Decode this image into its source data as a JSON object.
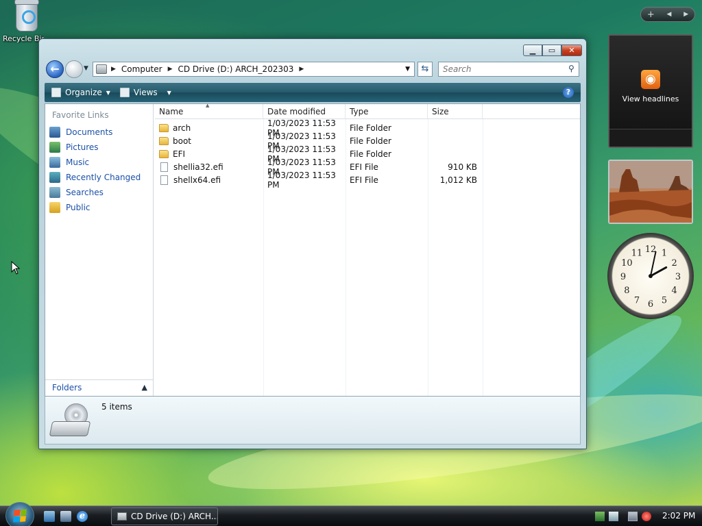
{
  "desktop": {
    "recycle_bin_label": "Recycle Bin"
  },
  "sidebar": {
    "rss_gadget_label": "View headlines",
    "clock_numbers": [
      "12",
      "1",
      "2",
      "3",
      "4",
      "5",
      "6",
      "7",
      "8",
      "9",
      "10",
      "11"
    ],
    "clock_time": {
      "hour": 2,
      "minute": 2
    }
  },
  "window": {
    "address": {
      "segments": [
        "Computer",
        "CD Drive (D:) ARCH_202303"
      ]
    },
    "search": {
      "placeholder": "Search"
    },
    "toolbar": {
      "organize_label": "Organize",
      "views_label": "Views"
    },
    "nav_pane": {
      "title": "Favorite Links",
      "items": [
        {
          "label": "Documents",
          "icon": "documents-icon"
        },
        {
          "label": "Pictures",
          "icon": "pictures-icon"
        },
        {
          "label": "Music",
          "icon": "music-icon"
        },
        {
          "label": "Recently Changed",
          "icon": "recently-changed-icon"
        },
        {
          "label": "Searches",
          "icon": "searches-icon"
        },
        {
          "label": "Public",
          "icon": "public-folder-icon"
        }
      ],
      "folders_label": "Folders"
    },
    "columns": {
      "name": "Name",
      "date": "Date modified",
      "type": "Type",
      "size": "Size"
    },
    "files": [
      {
        "name": "arch",
        "date": "1/03/2023 11:53 PM",
        "type": "File Folder",
        "size": "",
        "kind": "folder"
      },
      {
        "name": "boot",
        "date": "1/03/2023 11:53 PM",
        "type": "File Folder",
        "size": "",
        "kind": "folder"
      },
      {
        "name": "EFI",
        "date": "1/03/2023 11:53 PM",
        "type": "File Folder",
        "size": "",
        "kind": "folder"
      },
      {
        "name": "shellia32.efi",
        "date": "1/03/2023 11:53 PM",
        "type": "EFI File",
        "size": "910 KB",
        "kind": "file"
      },
      {
        "name": "shellx64.efi",
        "date": "1/03/2023 11:53 PM",
        "type": "EFI File",
        "size": "1,012 KB",
        "kind": "file"
      }
    ],
    "details": {
      "item_count": "5 items"
    }
  },
  "taskbar": {
    "task_button_label": "CD Drive (D:) ARCH...",
    "clock": "2:02 PM"
  }
}
